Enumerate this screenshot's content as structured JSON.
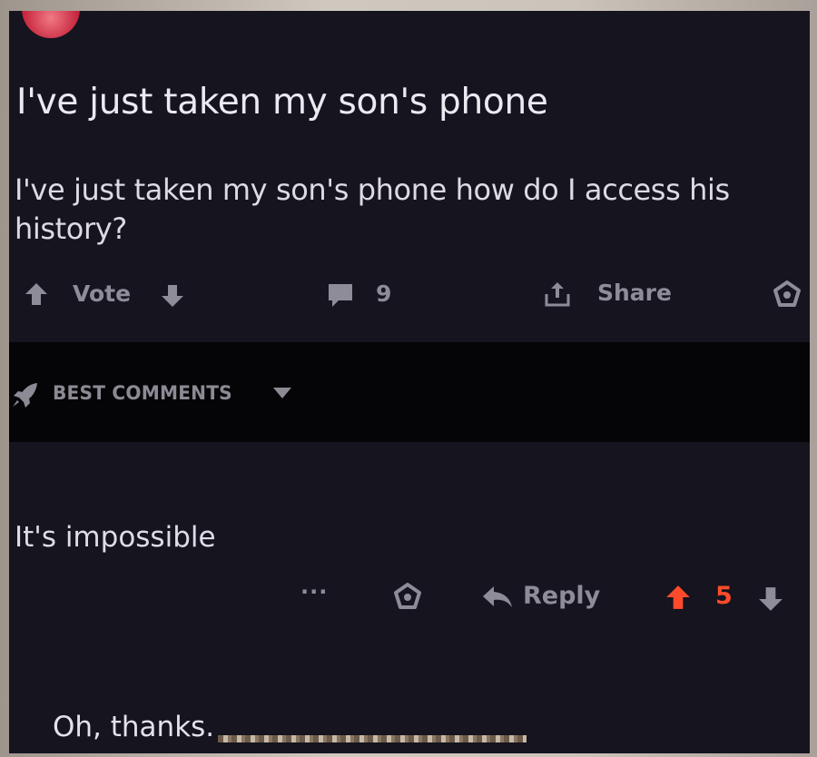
{
  "post": {
    "title": "I've just taken my son's phone",
    "body": "I've just taken my son's phone how do I access his history?",
    "vote_label": "Vote",
    "comment_count": "9",
    "share_label": "Share"
  },
  "comments_section": {
    "sort_label": "BEST COMMENTS"
  },
  "comment": {
    "text": "It's impossible",
    "more_label": "...",
    "reply_label": "Reply",
    "score": "5"
  },
  "caption": "Oh, thanks.",
  "colors": {
    "background": "#15141f",
    "text": "#dcdae3",
    "muted": "#8e8c98",
    "upvote_active": "#ff4b2b"
  },
  "icons": [
    "upvote-arrow-icon",
    "downvote-arrow-icon",
    "comment-bubble-icon",
    "share-icon",
    "award-icon",
    "rocket-icon",
    "caret-down-icon",
    "reply-arrow-icon"
  ]
}
